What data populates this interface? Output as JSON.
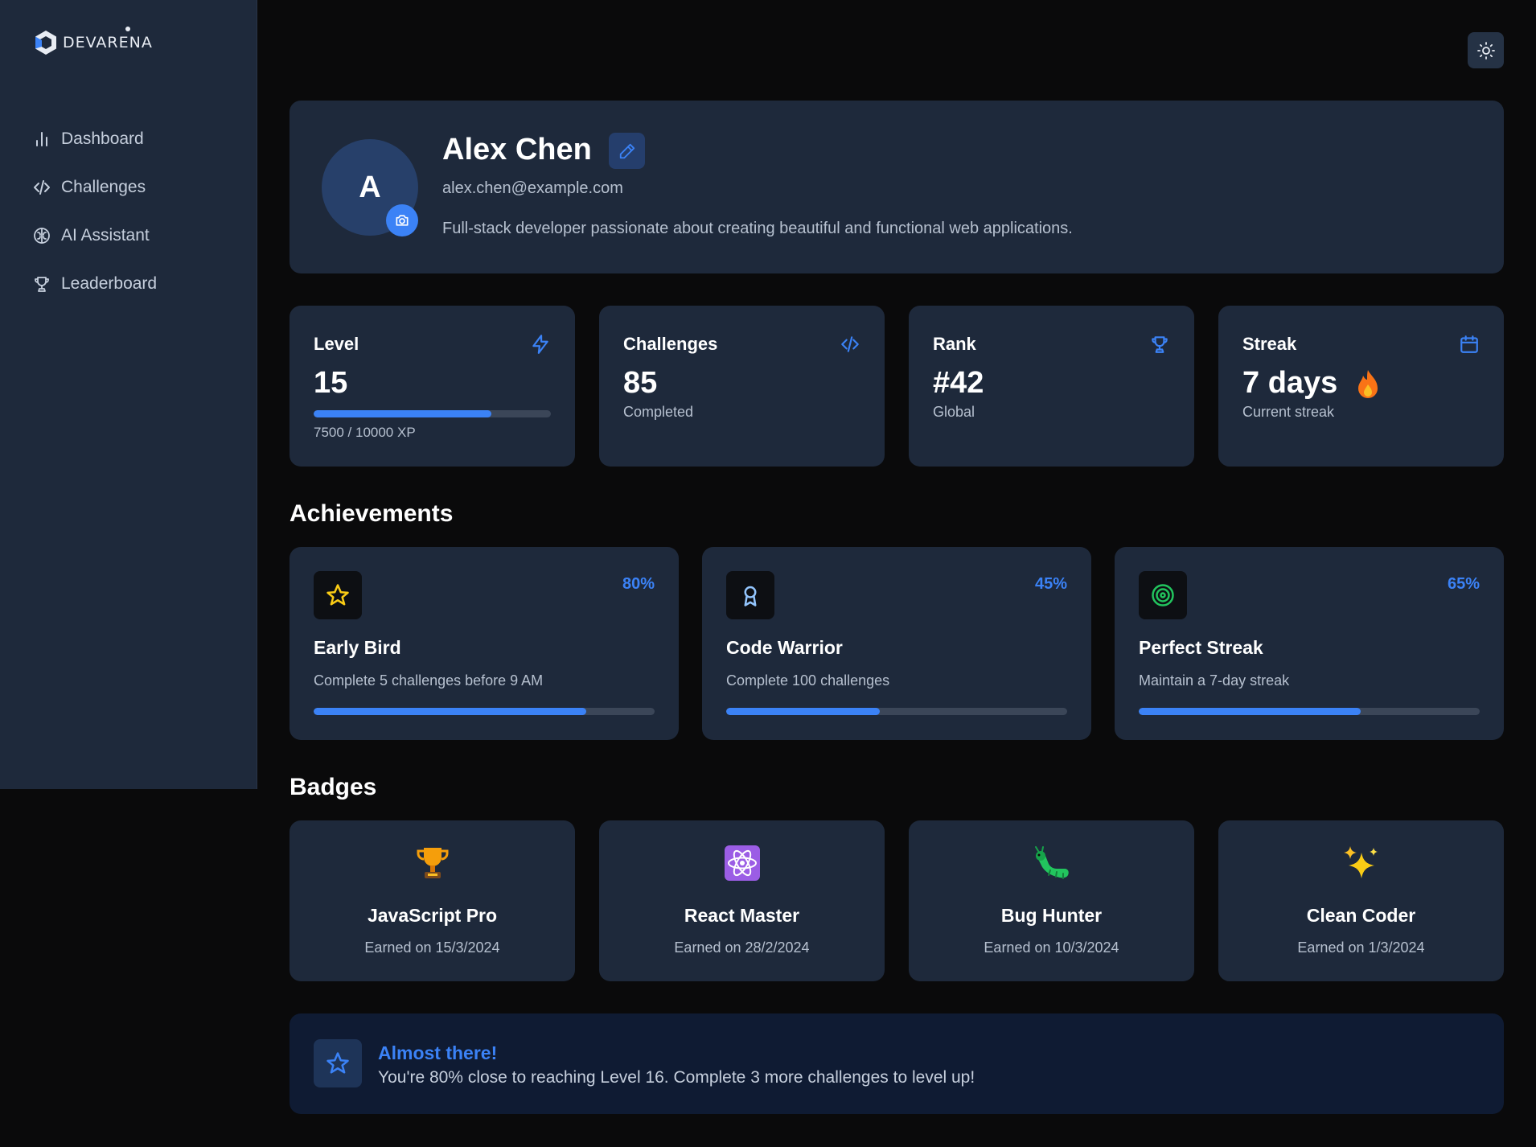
{
  "app": {
    "logo_text": "DEVARENA"
  },
  "sidebar": {
    "items": [
      {
        "label": "Dashboard",
        "icon": "bar-chart-icon"
      },
      {
        "label": "Challenges",
        "icon": "code-icon"
      },
      {
        "label": "AI Assistant",
        "icon": "brain-icon"
      },
      {
        "label": "Leaderboard",
        "icon": "trophy-icon"
      }
    ]
  },
  "profile": {
    "avatar_initial": "A",
    "name": "Alex Chen",
    "email": "alex.chen@example.com",
    "bio": "Full-stack developer passionate about creating beautiful and functional web applications."
  },
  "stats": {
    "level": {
      "title": "Level",
      "value": "15",
      "xp_text": "7500 / 10000 XP",
      "progress": 0.75
    },
    "challenges": {
      "title": "Challenges",
      "value": "85",
      "sub": "Completed"
    },
    "rank": {
      "title": "Rank",
      "value": "#42",
      "sub": "Global"
    },
    "streak": {
      "title": "Streak",
      "value": "7 days",
      "sub": "Current streak"
    }
  },
  "achievements": {
    "title": "Achievements",
    "items": [
      {
        "title": "Early Bird",
        "desc": "Complete 5 challenges before 9 AM",
        "pct_label": "80%",
        "progress": 0.8,
        "icon": "star-icon"
      },
      {
        "title": "Code Warrior",
        "desc": "Complete 100 challenges",
        "pct_label": "45%",
        "progress": 0.45,
        "icon": "award-icon"
      },
      {
        "title": "Perfect Streak",
        "desc": "Maintain a 7-day streak",
        "pct_label": "65%",
        "progress": 0.65,
        "icon": "target-icon"
      }
    ]
  },
  "badges": {
    "title": "Badges",
    "items": [
      {
        "name": "JavaScript Pro",
        "date": "Earned on 15/3/2024",
        "icon": "trophy-emoji-icon"
      },
      {
        "name": "React Master",
        "date": "Earned on 28/2/2024",
        "icon": "atom-emoji-icon"
      },
      {
        "name": "Bug Hunter",
        "date": "Earned on 10/3/2024",
        "icon": "bug-emoji-icon"
      },
      {
        "name": "Clean Coder",
        "date": "Earned on 1/3/2024",
        "icon": "sparkles-emoji-icon"
      }
    ]
  },
  "banner": {
    "title": "Almost there!",
    "text": "You're 80% close to reaching Level 16. Complete 3 more challenges to level up!"
  },
  "colors": {
    "accent": "#3b82f6",
    "card": "#1e293b",
    "background": "#0a0a0b",
    "sidebar": "#1e293b"
  }
}
